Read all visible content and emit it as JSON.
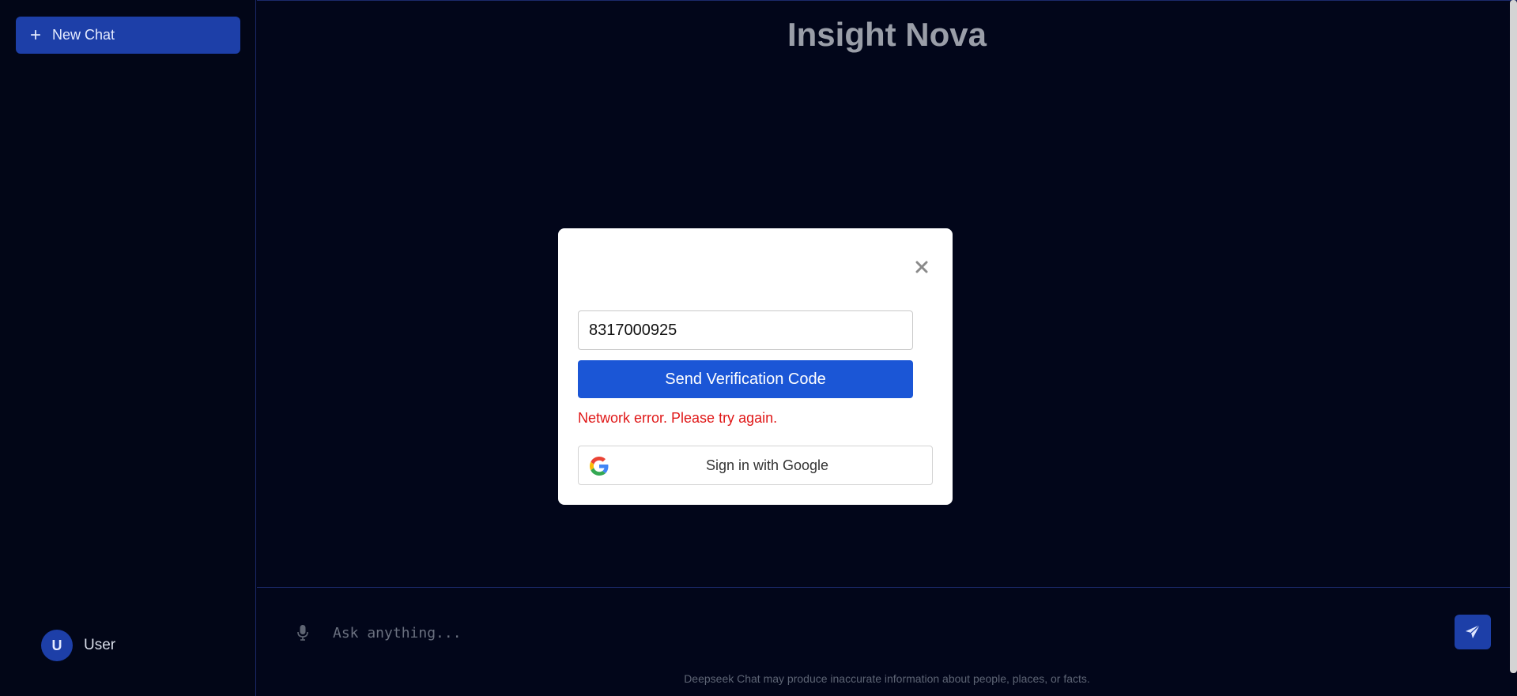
{
  "sidebar": {
    "new_chat_label": "New Chat",
    "user": {
      "initial": "U",
      "name": "User"
    }
  },
  "main": {
    "title": "Insight Nova",
    "input": {
      "placeholder": "Ask anything..."
    },
    "disclaimer": "Deepseek Chat may produce inaccurate information about people, places, or facts."
  },
  "modal": {
    "phone_value": "8317000925",
    "send_code_label": "Send Verification Code",
    "error_message": "Network error. Please try again.",
    "google_label": "Sign in with Google"
  },
  "icons": {
    "new_chat": "plus-icon",
    "mic": "microphone-icon",
    "send": "paper-plane-icon",
    "close": "close-icon",
    "google": "google-logo-icon"
  },
  "colors": {
    "background": "#02061a",
    "accent": "#1d3fa8",
    "primary_button": "#1b56d6",
    "error": "#e01818"
  }
}
